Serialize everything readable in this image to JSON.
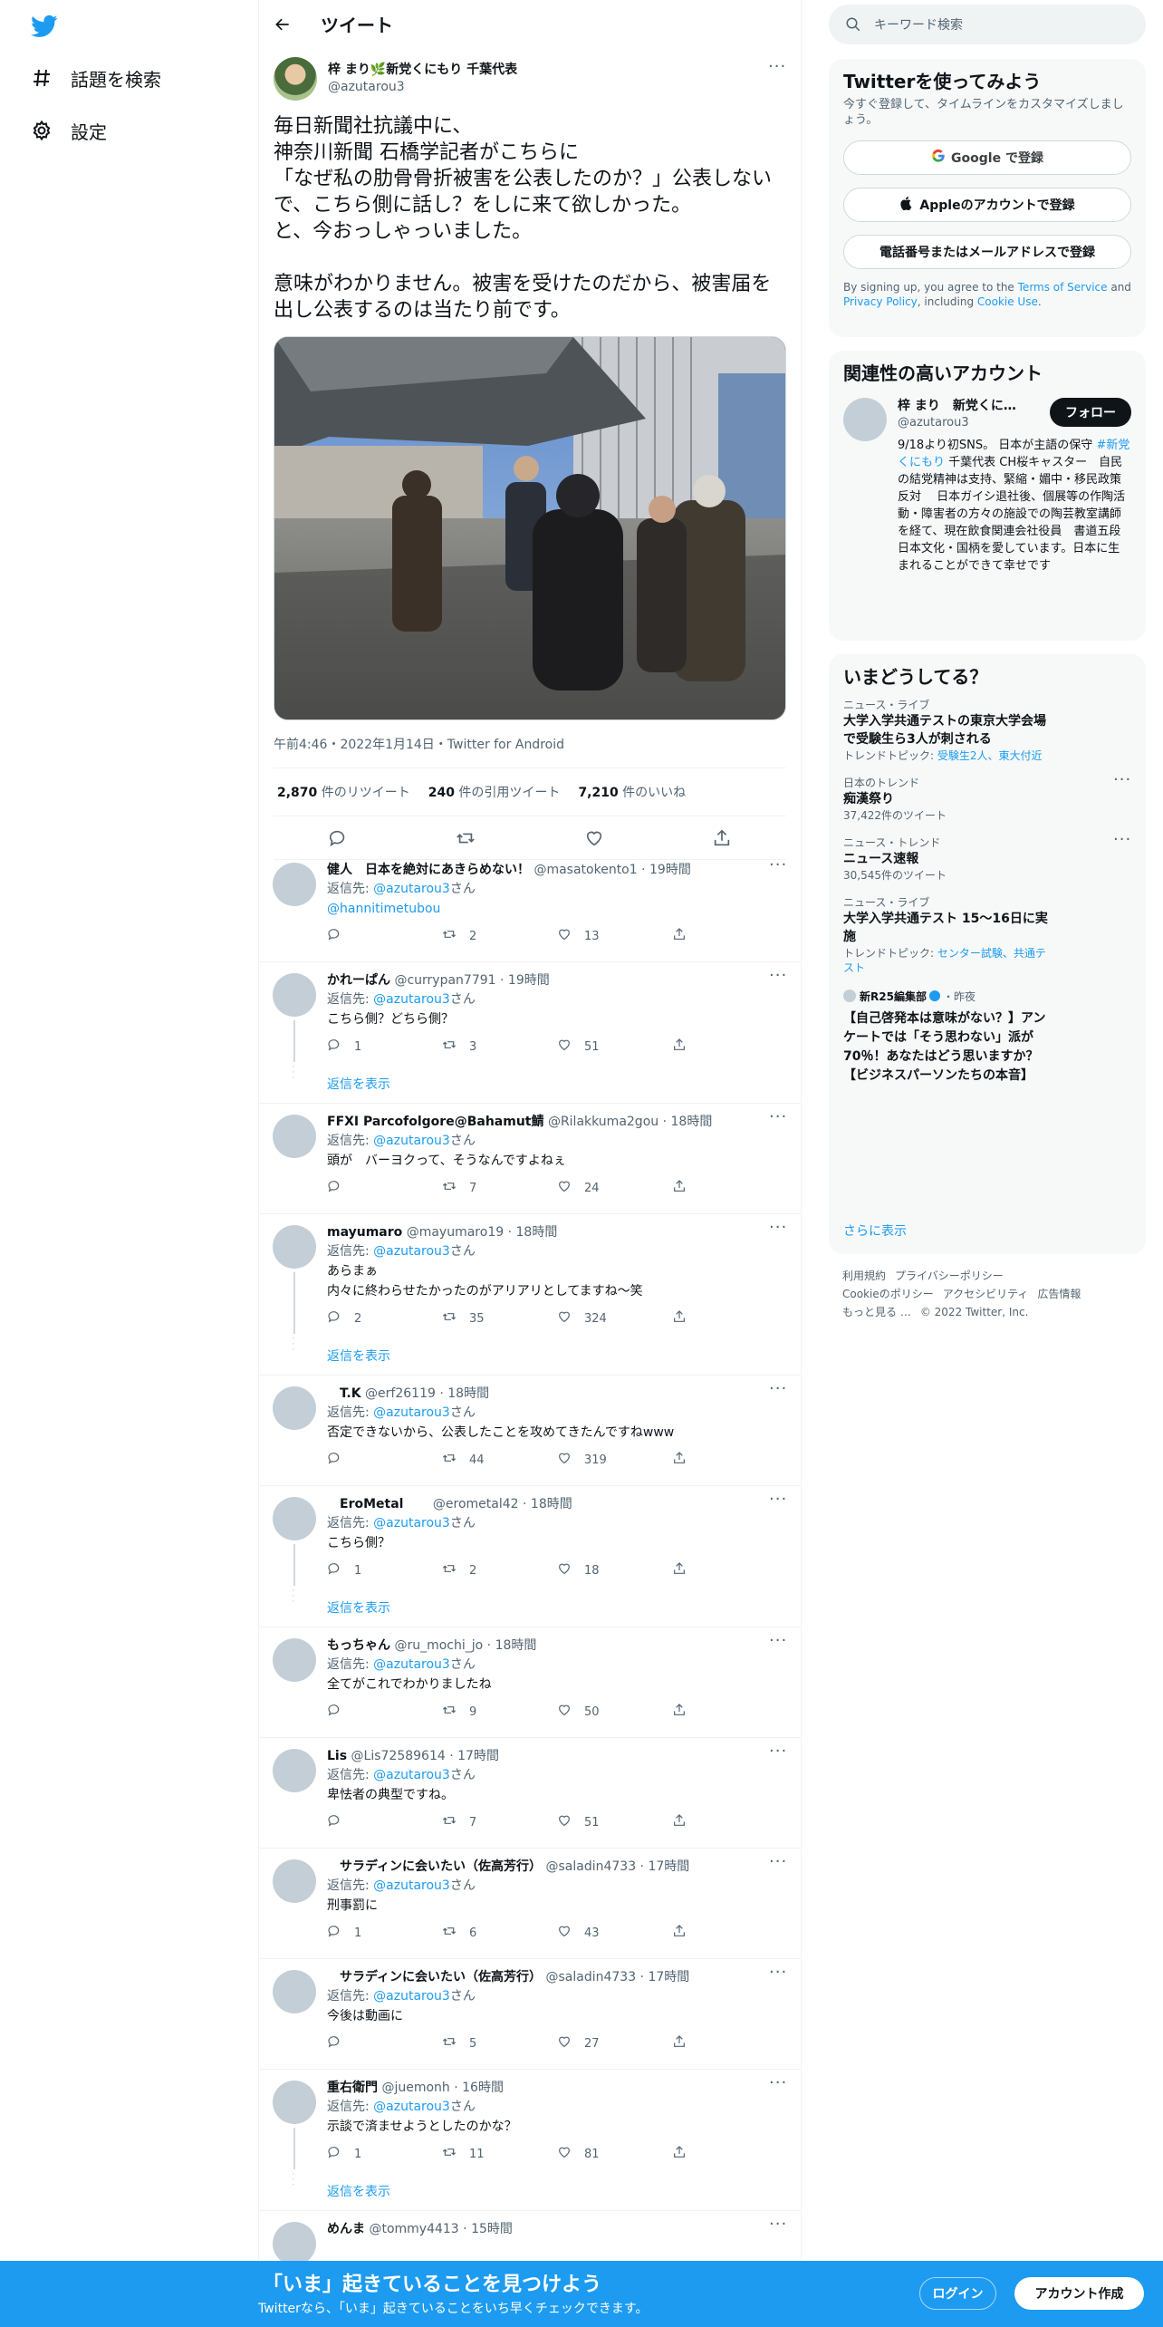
{
  "nav": {
    "explore": "話題を検索",
    "settings": "設定"
  },
  "header": {
    "title": "ツイート"
  },
  "tweet": {
    "display_name": "梓 まり🌿新党くにもり 千葉代表",
    "handle": "@azutarou3",
    "text": "毎日新聞社抗議中に、\n神奈川新聞 石橋学記者がこちらに\n「なぜ私の肋骨骨折被害を公表したのか？」公表しないで、こちら側に話し？をしに来て欲しかった。\nと、今おっしゃっいました。\n\n意味がわかりません。被害を受けたのだから、被害届を出し公表するのは当たり前です。",
    "meta": "午前4:46・2022年1月14日・Twitter for Android",
    "retweets_count": "2,870",
    "retweets_label": " 件のリツイート",
    "quotes_count": "240",
    "quotes_label": " 件の引用ツイート",
    "likes_count": "7,210",
    "likes_label": " 件のいいね"
  },
  "replies": [
    {
      "name": "健人　日本を絶対にあきらめない！",
      "handle": "@masatokento1",
      "time": "19時間",
      "to_prefix": "返信先: ",
      "to": "@azutarou3",
      "to_suffix": "さん",
      "text": "@hannitimetubou",
      "text_link": true,
      "reply": "",
      "rt": "2",
      "like": "13",
      "show_more": ""
    },
    {
      "name": "かれーぱん",
      "handle": "@currypan7791",
      "time": "19時間",
      "to_prefix": "返信先: ",
      "to": "@azutarou3",
      "to_suffix": "さん",
      "text": "こちら側？どちら側？",
      "reply": "1",
      "rt": "3",
      "like": "51",
      "show_more": "返信を表示"
    },
    {
      "name": "FFXI Parcofolgore@Bahamut鯖",
      "handle": "@Rilakkuma2gou",
      "time": "18時間",
      "to_prefix": "返信先: ",
      "to": "@azutarou3",
      "to_suffix": "さん",
      "text": "頭が　バーヨクって、そうなんですよねぇ",
      "reply": "",
      "rt": "7",
      "like": "24",
      "show_more": ""
    },
    {
      "name": "mayumaro",
      "handle": "@mayumaro19",
      "time": "18時間",
      "to_prefix": "返信先: ",
      "to": "@azutarou3",
      "to_suffix": "さん",
      "text": "あらまぁ\n内々に終わらせたかったのがアリアリとしてますね〜笑",
      "reply": "2",
      "rt": "35",
      "like": "324",
      "show_more": "返信を表示"
    },
    {
      "name": "　T.K",
      "handle": "@erf26119",
      "time": "18時間",
      "to_prefix": "返信先: ",
      "to": "@azutarou3",
      "to_suffix": "さん",
      "text": "否定できないから、公表したことを攻めてきたんですねwww",
      "reply": "",
      "rt": "44",
      "like": "319",
      "show_more": ""
    },
    {
      "name": "　EroMetal　　",
      "handle": "@erometal42",
      "time": "18時間",
      "to_prefix": "返信先: ",
      "to": "@azutarou3",
      "to_suffix": "さん",
      "text": "こちら側？",
      "reply": "1",
      "rt": "2",
      "like": "18",
      "show_more": "返信を表示"
    },
    {
      "name": "もっちゃん",
      "handle": "@ru_mochi_jo",
      "time": "18時間",
      "to_prefix": "返信先: ",
      "to": "@azutarou3",
      "to_suffix": "さん",
      "text": "全てがこれでわかりましたね",
      "reply": "",
      "rt": "9",
      "like": "50",
      "show_more": ""
    },
    {
      "name": "Lis",
      "handle": "@Lis72589614",
      "time": "17時間",
      "to_prefix": "返信先: ",
      "to": "@azutarou3",
      "to_suffix": "さん",
      "text": "卑怯者の典型ですね。",
      "reply": "",
      "rt": "7",
      "like": "51",
      "show_more": ""
    },
    {
      "name": "　サラディンに会いたい（佐高芳行）",
      "handle": "@saladin4733",
      "time": "17時間",
      "to_prefix": "返信先: ",
      "to": "@azutarou3",
      "to_suffix": "さん",
      "text": "刑事罰に",
      "reply": "1",
      "rt": "6",
      "like": "43",
      "show_more": ""
    },
    {
      "name": "　サラディンに会いたい（佐高芳行）",
      "handle": "@saladin4733",
      "time": "17時間",
      "to_prefix": "返信先: ",
      "to": "@azutarou3",
      "to_suffix": "さん",
      "text": "今後は動画に",
      "reply": "",
      "rt": "5",
      "like": "27",
      "show_more": ""
    },
    {
      "name": "重右衛門",
      "handle": "@juemonh",
      "time": "16時間",
      "to_prefix": "返信先: ",
      "to": "@azutarou3",
      "to_suffix": "さん",
      "text": "示談で済ませようとしたのかな？",
      "reply": "1",
      "rt": "11",
      "like": "81",
      "show_more": "返信を表示"
    },
    {
      "name": "めんま",
      "handle": "@tommy4413",
      "time": "15時間",
      "to_prefix": "",
      "to": "",
      "to_suffix": "",
      "text": "",
      "reply": "",
      "rt": "",
      "like": "",
      "show_more": ""
    }
  ],
  "search": {
    "placeholder": "キーワード検索"
  },
  "signup_card": {
    "title": "Twitterを使ってみよう",
    "subtitle": "今すぐ登録して、タイムラインをカスタマイズしましょう。",
    "google": "Google で登録",
    "apple": "Appleのアカウントで登録",
    "phone": "電話番号またはメールアドレスで登録",
    "legal_1": "By signing up, you agree to the ",
    "tos": "Terms of Service",
    "legal_2": " and ",
    "privacy": "Privacy Policy",
    "legal_3": ", including ",
    "cookie": "Cookie Use",
    "legal_4": "."
  },
  "related": {
    "title": "関連性の高いアカウント",
    "name": "梓 まり　新党くに…",
    "handle": "@azutarou3",
    "follow": "フォロー",
    "bio_1": "9/18より初SNS。 日本が主語の保守 ",
    "bio_tag": "#新党くにもり",
    "bio_2": " 千葉代表 CH桜キャスター　自民の結党精神は支持、緊縮・媚中・移民政策反対　 日本ガイシ退社後、個展等の作陶活動・障害者の方々の施設での陶芸教室講師を経て、現在飲食関連会社役員　書道五段　 日本文化・国柄を愛しています。日本に生まれることができて幸せです"
  },
  "trends": {
    "title": "いまどうしてる？",
    "items": [
      {
        "category": "ニュース・ライブ",
        "title": "大学入学共通テストの東京大学会場で受験生ら3人が刺される",
        "detail_prefix": "トレンドトピック: ",
        "detail": "受験生2人、東大付近",
        "count": ""
      },
      {
        "category": "日本のトレンド",
        "title": "痴漢祭り",
        "detail_prefix": "",
        "detail": "",
        "count": "37,422件のツイート"
      },
      {
        "category": "ニュース・トレンド",
        "title": "ニュース速報",
        "detail_prefix": "",
        "detail": "",
        "count": "30,545件のツイート"
      },
      {
        "category": "ニュース・ライブ",
        "title": "大学入学共通テスト 15〜16日に実施",
        "detail_prefix": "トレンドトピック: ",
        "detail": "センター試験、共通テスト",
        "count": ""
      }
    ],
    "promo_source": "新R25編集部",
    "promo_time": "・昨夜",
    "promo_title": "【自己啓発本は意味がない？】アンケートでは「そう思わない」派が70％！あなたはどう思いますか？【ビジネスパーソンたちの本音】",
    "show_more": "さらに表示"
  },
  "footer": {
    "line1": [
      "利用規約",
      "プライバシーポリシー"
    ],
    "line2": [
      "Cookieのポリシー",
      "アクセシビリティ",
      "広告情報"
    ],
    "line3": [
      "もっと見る …",
      "© 2022 Twitter, Inc."
    ]
  },
  "bottom_bar": {
    "title": "「いま」起きていることを見つけよう",
    "subtitle": "Twitterなら、「いま」起きていることをいち早くチェックできます。",
    "login": "ログイン",
    "signup": "アカウント作成"
  },
  "colors": {
    "accent": "#1d9bf0",
    "text": "#0f1419",
    "muted": "#536471"
  }
}
